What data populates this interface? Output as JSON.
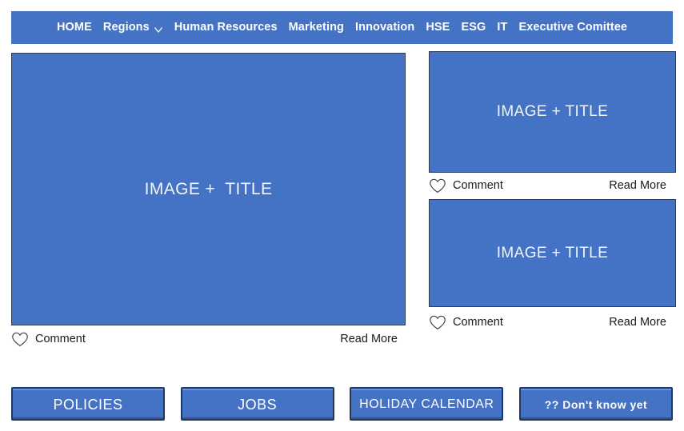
{
  "nav": {
    "items": [
      {
        "label": "HOME",
        "icon": null
      },
      {
        "label": "Regions",
        "icon": "chevron-down-icon"
      },
      {
        "label": "Human Resources",
        "icon": null
      },
      {
        "label": "Marketing",
        "icon": null
      },
      {
        "label": "Innovation",
        "icon": null
      },
      {
        "label": "HSE",
        "icon": null
      },
      {
        "label": "ESG",
        "icon": null
      },
      {
        "label": "IT",
        "icon": null
      },
      {
        "label": "Executive Comittee",
        "icon": null
      }
    ]
  },
  "cards": {
    "hero": {
      "caption": "IMAGE +  TITLE",
      "comment_label": "Comment",
      "read_more_label": "Read More",
      "heart_icon": "heart-outline-icon"
    },
    "side_top": {
      "caption": "IMAGE + TITLE",
      "comment_label": "Comment",
      "read_more_label": "Read More",
      "heart_icon": "heart-outline-icon"
    },
    "side_bottom": {
      "caption": "IMAGE + TITLE",
      "comment_label": "Comment",
      "read_more_label": "Read More",
      "heart_icon": "heart-outline-icon"
    }
  },
  "buttons": [
    {
      "label": "POLICIES"
    },
    {
      "label": "JOBS"
    },
    {
      "label": "HOLIDAY CALENDAR"
    },
    {
      "label": "?? Don't know yet"
    }
  ],
  "colors": {
    "brand_blue": "#4472C4",
    "nav_blue": "#4472C4",
    "button_border": "#1f3864",
    "button_highlight": "#6b93dd",
    "card_border": "#2f3d55",
    "text_dark": "#1b1b1b",
    "text_light": "#ffffff"
  }
}
